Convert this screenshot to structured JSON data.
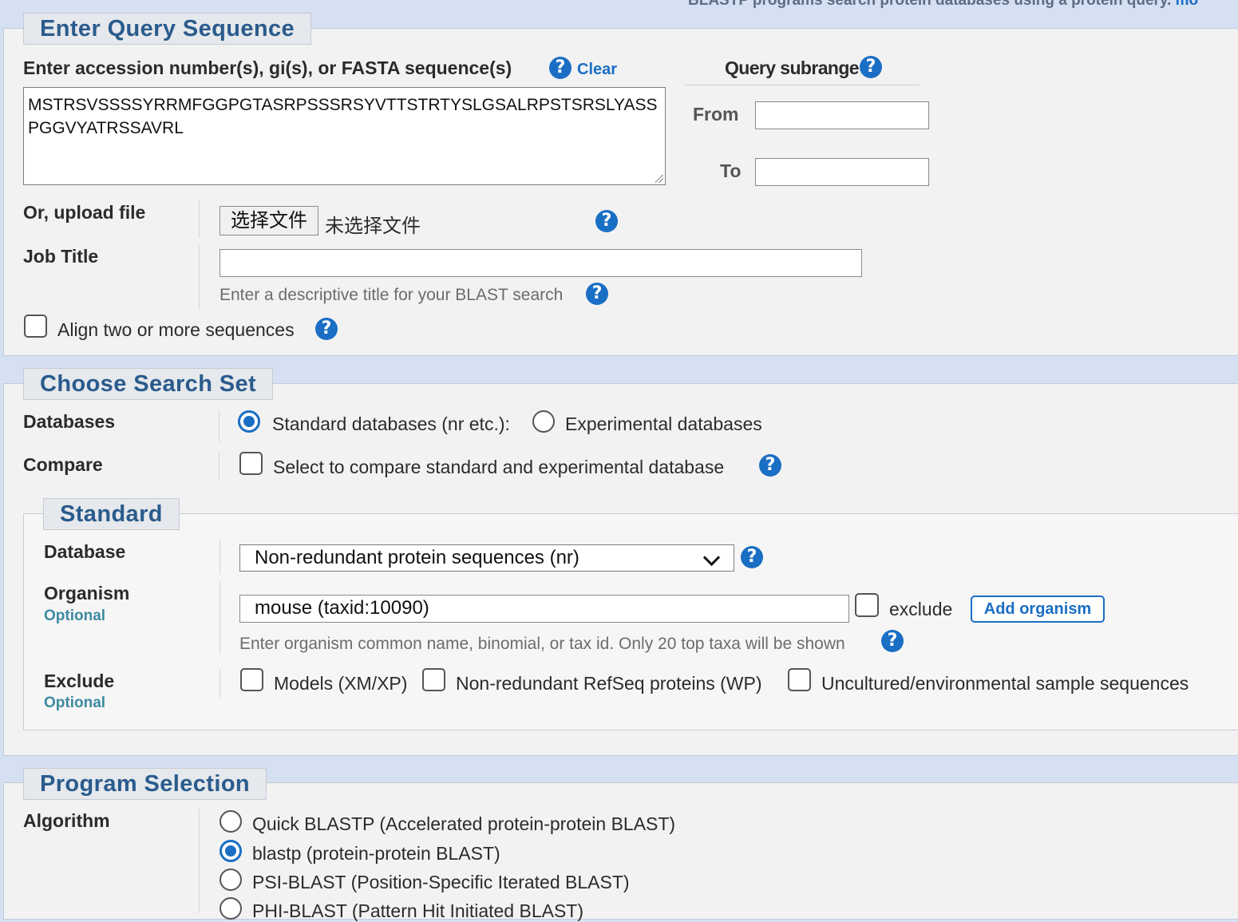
{
  "top_note": {
    "text": "BLASTP programs search protein databases using a protein query.",
    "link": "mo"
  },
  "query": {
    "legend": "Enter Query Sequence",
    "accession_label": "Enter accession number(s), gi(s), or FASTA sequence(s)",
    "clear_link": "Clear",
    "sequence": "MSTRSVSSSSYRRMFGGPGTASRPSSSRSYVTTSTRTYSLGSALRPSTSRSLYASSPGGVYATRSSAVRL",
    "subrange_label": "Query subrange",
    "from_label": "From",
    "to_label": "To",
    "from_value": "",
    "to_value": "",
    "upload_label": "Or, upload file",
    "file_button": "选择文件",
    "file_status": "未选择文件",
    "job_title_label": "Job Title",
    "job_title_value": "",
    "job_title_hint": "Enter a descriptive title for your BLAST search",
    "align_label": "Align two or more sequences"
  },
  "search_set": {
    "legend": "Choose Search Set",
    "databases_label": "Databases",
    "standard_db_option": "Standard databases (nr etc.):",
    "experimental_db_option": "Experimental databases",
    "compare_label": "Compare",
    "compare_option": "Select to compare standard and experimental database",
    "standard": {
      "legend": "Standard",
      "database_label": "Database",
      "database_selected": "Non-redundant protein sequences (nr)",
      "organism_label": "Organism",
      "optional": "Optional",
      "organism_value": "mouse (taxid:10090)",
      "exclude_checkbox": "exclude",
      "add_organism": "Add organism",
      "organism_hint": "Enter organism common name, binomial, or tax id. Only 20 top taxa will be shown",
      "exclude_label": "Exclude",
      "exclude_models": "Models (XM/XP)",
      "exclude_refseq": "Non-redundant RefSeq proteins (WP)",
      "exclude_uncultured": "Uncultured/environmental sample sequences"
    }
  },
  "program": {
    "legend": "Program Selection",
    "algorithm_label": "Algorithm",
    "options": [
      "Quick BLASTP (Accelerated protein-protein BLAST)",
      "blastp (protein-protein BLAST)",
      "PSI-BLAST (Position-Specific Iterated BLAST)",
      "PHI-BLAST (Pattern Hit Initiated BLAST)"
    ],
    "selected": "blastp (protein-protein BLAST)"
  },
  "colors": {
    "accent": "#1a6ec4",
    "legend_text": "#2a5b8c",
    "background": "#d5e0f2",
    "panel": "#f2f2f2"
  }
}
